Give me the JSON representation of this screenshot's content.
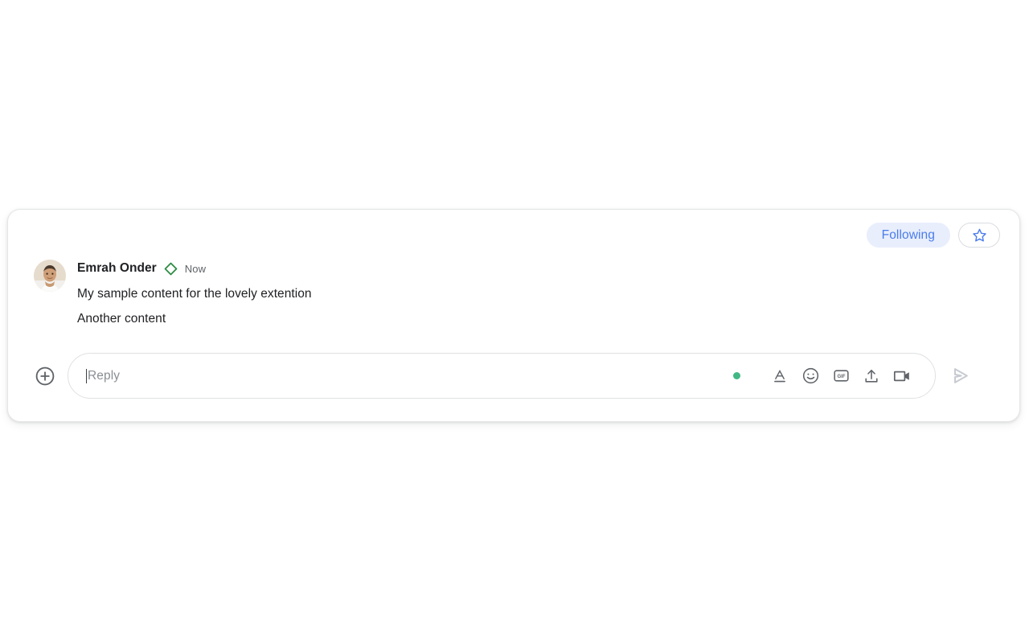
{
  "card": {
    "actions": {
      "following_label": "Following",
      "following_bg": "#e8eefc",
      "following_color": "#4a7ceb",
      "star_icon": "star-outline-icon",
      "star_color": "#4a7ceb"
    },
    "message": {
      "avatar": "user-avatar-photo",
      "sender_name": "Emrah Onder",
      "badge_icon": "green-diamond-badge-icon",
      "badge_color": "#2e8b43",
      "timestamp": "Now",
      "lines": [
        "My sample content for the lovely extention",
        "Another content"
      ]
    },
    "reply": {
      "add_icon": "plus-circle-icon",
      "placeholder": "Reply",
      "value": "",
      "status_dot_color": "#41b883",
      "tools": [
        {
          "name": "format-text-icon",
          "label": "A"
        },
        {
          "name": "emoji-icon",
          "label": ""
        },
        {
          "name": "gif-icon",
          "label": "GIF"
        },
        {
          "name": "upload-icon",
          "label": ""
        },
        {
          "name": "video-camera-icon",
          "label": ""
        }
      ],
      "send_icon": "send-icon",
      "send_color": "#c7cbd1"
    }
  }
}
